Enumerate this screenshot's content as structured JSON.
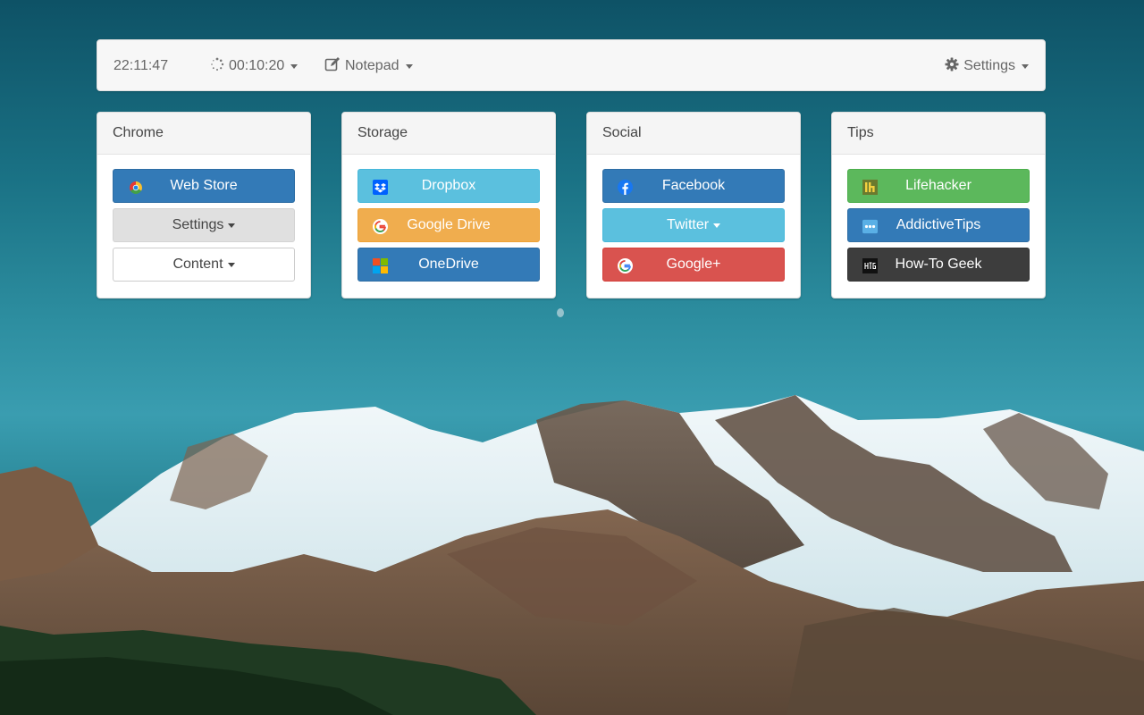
{
  "topbar": {
    "clock": "22:11:47",
    "timer_label": "00:10:20",
    "notepad_label": "Notepad",
    "settings_label": "Settings"
  },
  "panels": [
    {
      "title": "Chrome",
      "buttons": [
        {
          "label": "Web Store",
          "icon": "chrome-icon"
        },
        {
          "label": "Settings",
          "dropdown": true
        },
        {
          "label": "Content",
          "dropdown": true
        }
      ]
    },
    {
      "title": "Storage",
      "buttons": [
        {
          "label": "Dropbox",
          "icon": "dropbox-icon"
        },
        {
          "label": "Google Drive",
          "icon": "google-icon"
        },
        {
          "label": "OneDrive",
          "icon": "microsoft-icon"
        }
      ]
    },
    {
      "title": "Social",
      "buttons": [
        {
          "label": "Facebook",
          "icon": "facebook-icon"
        },
        {
          "label": "Twitter",
          "dropdown": true
        },
        {
          "label": "Google+",
          "icon": "google-icon"
        }
      ]
    },
    {
      "title": "Tips",
      "buttons": [
        {
          "label": "Lifehacker",
          "icon": "lifehacker-icon"
        },
        {
          "label": "AddictiveTips",
          "icon": "addictivetips-icon"
        },
        {
          "label": "How-To Geek",
          "icon": "htg-icon"
        }
      ]
    }
  ],
  "colors": {
    "primary": "#337ab7",
    "info": "#5bc0de",
    "warning": "#f0ad4e",
    "danger": "#d9534f",
    "success": "#5cb85c",
    "dark": "#3d3d3d"
  }
}
